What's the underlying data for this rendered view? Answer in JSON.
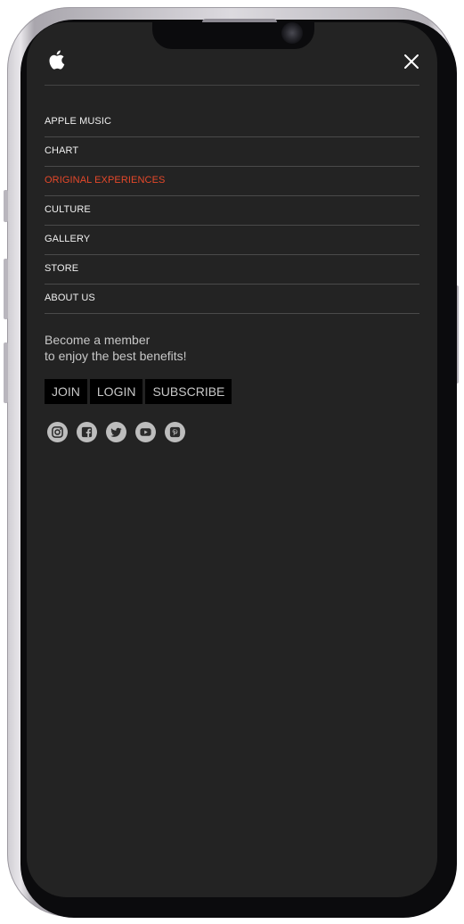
{
  "menu": {
    "items": [
      {
        "label": "APPLE MUSIC"
      },
      {
        "label": "CHART"
      },
      {
        "label": "ORIGINAL EXPERIENCES"
      },
      {
        "label": "CULTURE"
      },
      {
        "label": "GALLERY"
      },
      {
        "label": "STORE"
      },
      {
        "label": "ABOUT US"
      }
    ],
    "active_index": 2
  },
  "promo": {
    "line1": "Become a member",
    "line2": "to enjoy the best benefits!"
  },
  "actions": {
    "join": "JOIN",
    "login": "LOGIN",
    "subscribe": "SUBSCRIBE"
  },
  "social": [
    "instagram-icon",
    "facebook-icon",
    "twitter-icon",
    "youtube-icon",
    "pinterest-icon"
  ],
  "colors": {
    "background": "#232323",
    "active": "#e5482a",
    "text": "#f0f0f0",
    "button_bg": "#000000"
  }
}
